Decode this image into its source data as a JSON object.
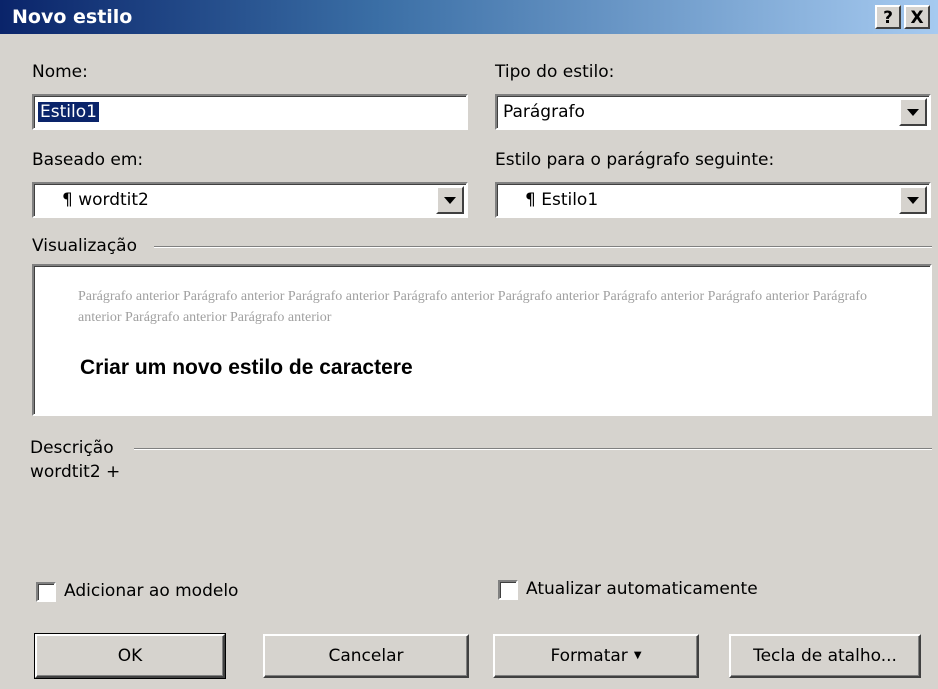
{
  "window": {
    "title": "Novo estilo",
    "help_label": "?",
    "close_label": "X"
  },
  "nome": {
    "label": "Nome:",
    "value": "Estilo1"
  },
  "tipo": {
    "label": "Tipo do estilo:",
    "value": "Parágrafo"
  },
  "baseado": {
    "label": "Baseado em:",
    "value": "¶ wordtit2"
  },
  "seguinte": {
    "label": "Estilo para o parágrafo seguinte:",
    "value": "¶ Estilo1"
  },
  "visualizacao": {
    "label": "Visualização",
    "previous_text": "Parágrafo anterior Parágrafo anterior Parágrafo anterior Parágrafo anterior Parágrafo anterior Parágrafo anterior Parágrafo anterior Parágrafo anterior Parágrafo anterior Parágrafo anterior",
    "sample_text": "Criar um novo estilo de caractere"
  },
  "descricao": {
    "label": "Descrição",
    "value": "wordtit2 +"
  },
  "options": {
    "add_to_template_label": "Adicionar ao modelo",
    "add_to_template_checked": false,
    "auto_update_label": "Atualizar automaticamente",
    "auto_update_checked": false
  },
  "buttons": {
    "ok": "OK",
    "cancel": "Cancelar",
    "format": "Formatar",
    "shortcut": "Tecla de atalho..."
  }
}
